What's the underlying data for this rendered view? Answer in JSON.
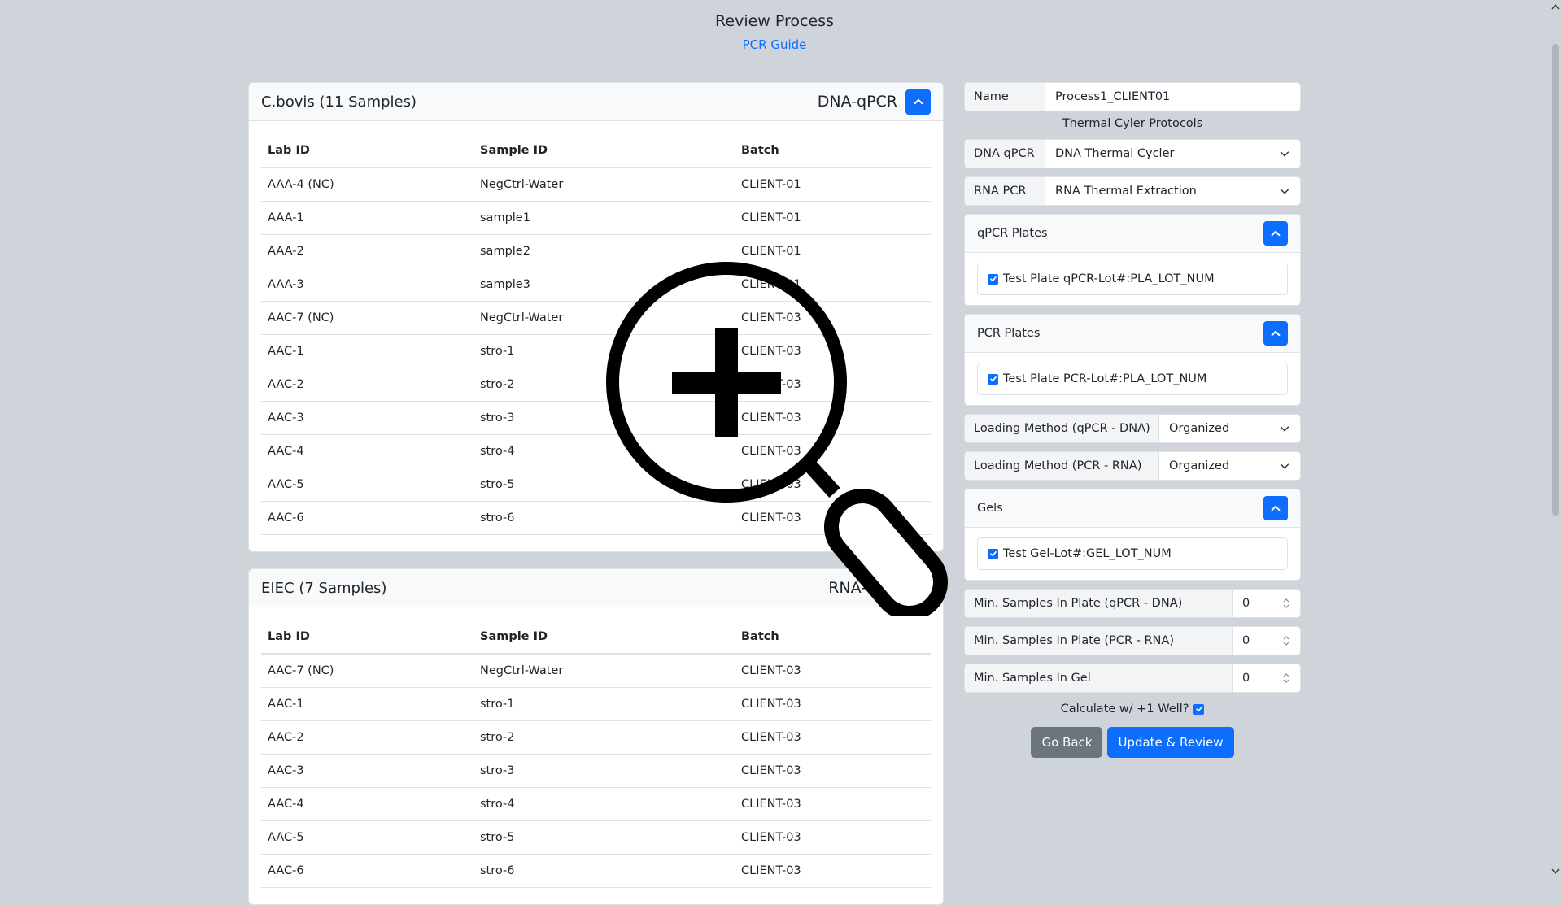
{
  "page": {
    "title": "Review Process",
    "guide_link": "PCR Guide"
  },
  "columns": [
    "Lab ID",
    "Sample ID",
    "Batch"
  ],
  "cards": [
    {
      "title": "C.bovis (11 Samples)",
      "type": "DNA-qPCR",
      "rows": [
        [
          "AAA-4 (NC)",
          "NegCtrl-Water",
          "CLIENT-01"
        ],
        [
          "AAA-1",
          "sample1",
          "CLIENT-01"
        ],
        [
          "AAA-2",
          "sample2",
          "CLIENT-01"
        ],
        [
          "AAA-3",
          "sample3",
          "CLIENT-01"
        ],
        [
          "AAC-7 (NC)",
          "NegCtrl-Water",
          "CLIENT-03"
        ],
        [
          "AAC-1",
          "stro-1",
          "CLIENT-03"
        ],
        [
          "AAC-2",
          "stro-2",
          "CLIENT-03"
        ],
        [
          "AAC-3",
          "stro-3",
          "CLIENT-03"
        ],
        [
          "AAC-4",
          "stro-4",
          "CLIENT-03"
        ],
        [
          "AAC-5",
          "stro-5",
          "CLIENT-03"
        ],
        [
          "AAC-6",
          "stro-6",
          "CLIENT-03"
        ]
      ]
    },
    {
      "title": "EIEC (7 Samples)",
      "type": "RNA-PCR",
      "rows": [
        [
          "AAC-7 (NC)",
          "NegCtrl-Water",
          "CLIENT-03"
        ],
        [
          "AAC-1",
          "stro-1",
          "CLIENT-03"
        ],
        [
          "AAC-2",
          "stro-2",
          "CLIENT-03"
        ],
        [
          "AAC-3",
          "stro-3",
          "CLIENT-03"
        ],
        [
          "AAC-4",
          "stro-4",
          "CLIENT-03"
        ],
        [
          "AAC-5",
          "stro-5",
          "CLIENT-03"
        ],
        [
          "AAC-6",
          "stro-6",
          "CLIENT-03"
        ]
      ]
    }
  ],
  "side": {
    "name_label": "Name",
    "name_value": "Process1_CLIENT01",
    "protocols_heading": "Thermal Cyler Protocols",
    "dna_label": "DNA qPCR",
    "dna_value": "DNA Thermal Cycler",
    "rna_label": "RNA PCR",
    "rna_value": "RNA Thermal Extraction",
    "qpcr_plates_title": "qPCR Plates",
    "qpcr_plate_item": "Test Plate qPCR-Lot#:PLA_LOT_NUM",
    "pcr_plates_title": "PCR Plates",
    "pcr_plate_item": "Test Plate PCR-Lot#:PLA_LOT_NUM",
    "loading_dna_label": "Loading Method (qPCR - DNA)",
    "loading_dna_value": "Organized",
    "loading_rna_label": "Loading Method (PCR - RNA)",
    "loading_rna_value": "Organized",
    "gels_title": "Gels",
    "gel_item": "Test Gel-Lot#:GEL_LOT_NUM",
    "min_dna_label": "Min. Samples In Plate (qPCR - DNA)",
    "min_dna_value": "0",
    "min_rna_label": "Min. Samples In Plate (PCR - RNA)",
    "min_rna_value": "0",
    "min_gel_label": "Min. Samples In Gel",
    "min_gel_value": "0",
    "calc_label": "Calculate w/ +1 Well?",
    "go_back": "Go Back",
    "update_review": "Update & Review"
  },
  "colors": {
    "primary": "#0d6efd",
    "secondary": "#6c757d",
    "background": "#ced4da"
  },
  "icons": {
    "toggle": "chevron-up-icon",
    "select": "chevron-down-icon",
    "overlay": "zoom-in-magnifier-icon"
  }
}
